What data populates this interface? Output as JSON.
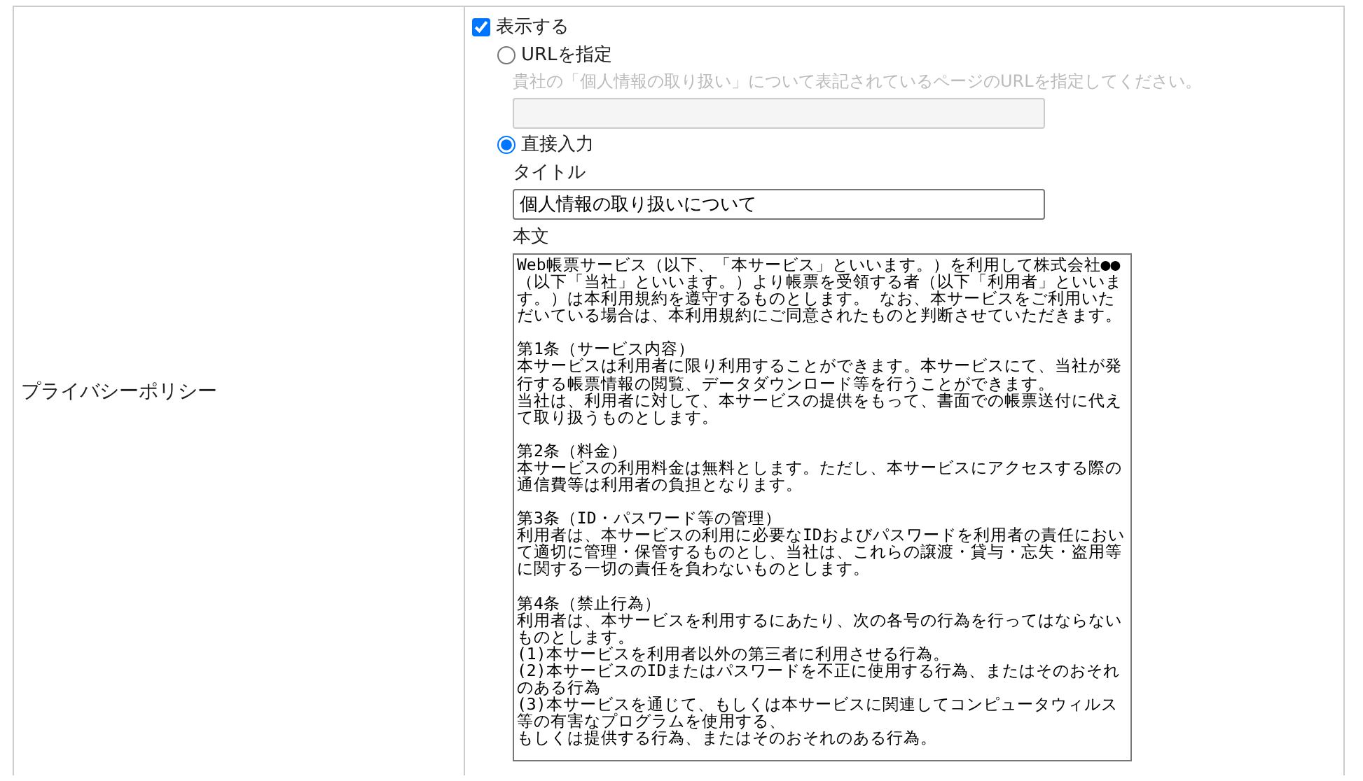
{
  "row": {
    "label": "プライバシーポリシー"
  },
  "display": {
    "label": "表示する",
    "checked": true
  },
  "options": [
    {
      "kind": "url",
      "label": "URLを指定",
      "selected": false,
      "hint": "貴社の「個人情報の取り扱い」について表記されているページのURLを指定してください。"
    },
    {
      "kind": "direct",
      "label": "直接入力",
      "selected": true,
      "title_label": "タイトル",
      "title_value": "個人情報の取り扱いについて",
      "body_label": "本文",
      "body_paragraphs": [
        [
          "Web帳票サービス（以下、「本サービス」といいます。）を利用して株式会社●●（以下「当社」といいます。）より帳票を受領する者（以下「利用者」といいます。）は本利用規約を遵守するものとします。 なお、本サービスをご利用いただいている場合は、本利用規約にご同意されたものと判断させていただきます。"
        ],
        [
          "第1条（サービス内容）",
          "本サービスは利用者に限り利用することができます。本サービスにて、当社が発行する帳票情報の閲覧、データダウンロード等を行うことができます。",
          "当社は、利用者に対して、本サービスの提供をもって、書面での帳票送付に代えて取り扱うものとします。"
        ],
        [
          "第2条（料金）",
          "本サービスの利用料金は無料とします。ただし、本サービスにアクセスする際の通信費等は利用者の負担となります。"
        ],
        [
          "第3条（ID・パスワード等の管理）",
          "利用者は、本サービスの利用に必要なIDおよびパスワードを利用者の責任において適切に管理・保管するものとし、当社は、これらの譲渡・貸与・忘失・盗用等に関する一切の責任を負わないものとします。"
        ],
        [
          "第4条（禁止行為）",
          "利用者は、本サービスを利用するにあたり、次の各号の行為を行ってはならないものとします。",
          "(1)本サービスを利用者以外の第三者に利用させる行為。",
          "(2)本サービスのIDまたはパスワードを不正に使用する行為、またはそのおそれのある行為",
          "(3)本サービスを通じて、もしくは本サービスに関連してコンピュータウィルス等の有害なプログラムを使用する、",
          "もしくは提供する行為、またはそのおそれのある行為。"
        ]
      ]
    }
  ]
}
